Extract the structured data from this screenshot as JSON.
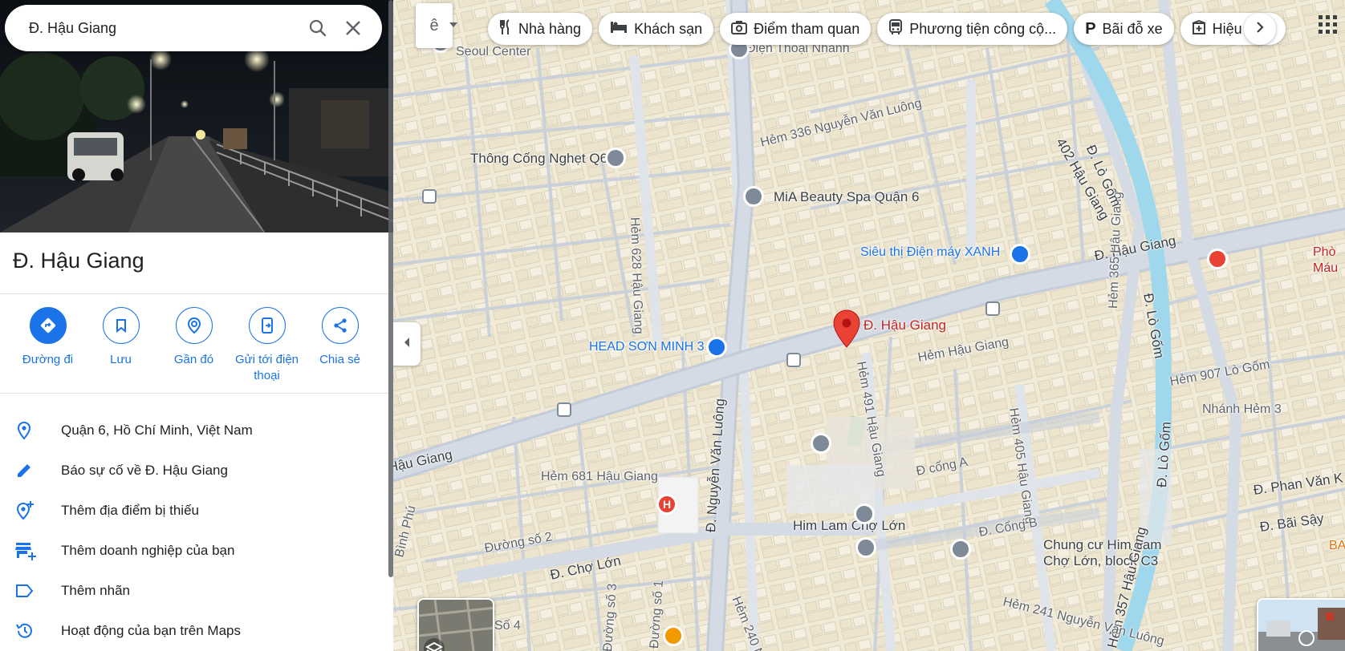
{
  "search": {
    "query": "Đ. Hậu Giang"
  },
  "place": {
    "title": "Đ. Hậu Giang"
  },
  "actions": [
    {
      "label": "Đường đi",
      "icon": "directions-icon"
    },
    {
      "label": "Lưu",
      "icon": "bookmark-icon"
    },
    {
      "label": "Gần đó",
      "icon": "nearby-icon"
    },
    {
      "label": "Gửi tới điện thoại",
      "icon": "send-to-phone-icon"
    },
    {
      "label": "Chia sẻ",
      "icon": "share-icon"
    }
  ],
  "info_rows": [
    {
      "text": "Quận 6, Hồ Chí Minh, Việt Nam",
      "icon": "location-pin-icon"
    },
    {
      "text": "Báo sự cố về Đ. Hậu Giang",
      "icon": "edit-pencil-icon"
    },
    {
      "text": "Thêm địa điểm bị thiếu",
      "icon": "add-place-icon"
    },
    {
      "text": "Thêm doanh nghiệp của bạn",
      "icon": "add-business-icon"
    },
    {
      "text": "Thêm nhãn",
      "icon": "label-icon"
    },
    {
      "text": "Hoạt động của bạn trên Maps",
      "icon": "history-icon"
    }
  ],
  "chips": [
    {
      "label": "Nhà hàng",
      "icon": "restaurant-icon"
    },
    {
      "label": "Khách sạn",
      "icon": "hotel-icon"
    },
    {
      "label": "Điểm tham quan",
      "icon": "camera-icon"
    },
    {
      "label": "Phương tiện công cộ...",
      "icon": "transit-icon"
    },
    {
      "label": "Bãi đỗ xe",
      "icon": "parking-icon"
    },
    {
      "label": "Hiệu",
      "icon": "pharmacy-icon"
    }
  ],
  "map_labels": {
    "seoul_center": "Seoul Center",
    "dien_thoai_nhanh": "Điện Thoại Nhanh",
    "thong_cong": "Thông Cống Nghẹt Q6",
    "hem336": "Hẻm 336 Nguyễn Văn Luông",
    "mia_spa": "MiA Beauty Spa Quận 6",
    "sieu_thi": "Siêu thị Điện máy XANH",
    "hau_giang_e": "Đ. Hậu Giang",
    "pho_mau_1": "Phò",
    "pho_mau_2": "Máu",
    "head_son_minh": "HEAD SƠN MINH 3",
    "pin_label": "Đ. Hậu Giang",
    "hem_hau_giang": "Hẻm Hậu Giang",
    "hem628": "Hẻm 628 Hậu Giang",
    "hem491": "Hẻm 491 Hậu Giang",
    "hem365": "Hẻm 365 Hậu Giang",
    "hem907": "Hẻm 907 Lò Gốm",
    "nhanh_hem": "Nhánh Hẻm 3",
    "hau_giang_w": "Hậu Giang",
    "nguyen_van_luong": "Đ. Nguyễn Văn Luông",
    "hem681": "Hẻm 681 Hậu Giang",
    "d_cong_a": "Đ cổng A",
    "hem405": "Hẻm 405 Hậu Giang",
    "lo_gom_1": "Đ. Lò Gốm",
    "lo_gom_2": "Đ. Lò Gốm",
    "lo_gom_3": "Đ. Lò Gốm",
    "phan_van": "Đ. Phan Văn K",
    "bai_say": "Đ. Bãi Sậy",
    "binh_phu": "Bình Phú",
    "duong_so_2": "Đường số 2",
    "cho_lon": "Đ. Chợ Lớn",
    "him_lam": "Him Lam Chợ Lớn",
    "cong_b": "Đ. Cổng B",
    "chung_cu_1": "Chung cư Him Lam",
    "chung_cu_2": "Chợ Lớn, block C3",
    "hem357": "Hẻm 357 Hậu Giang",
    "hem241": "Hẻm 241 Nguyễn Văn Luông",
    "duong_so_3": "Đường số 3",
    "duong_so_1": "Đường số 1",
    "hem240": "Hẻm 240 Ng",
    "so4": "Số 4",
    "hg402": "402 Hậu Giang",
    "ba": "BA"
  },
  "colors": {
    "accent": "#1a73e8",
    "pin": "#ea4335",
    "canal": "#9fd7ec"
  }
}
